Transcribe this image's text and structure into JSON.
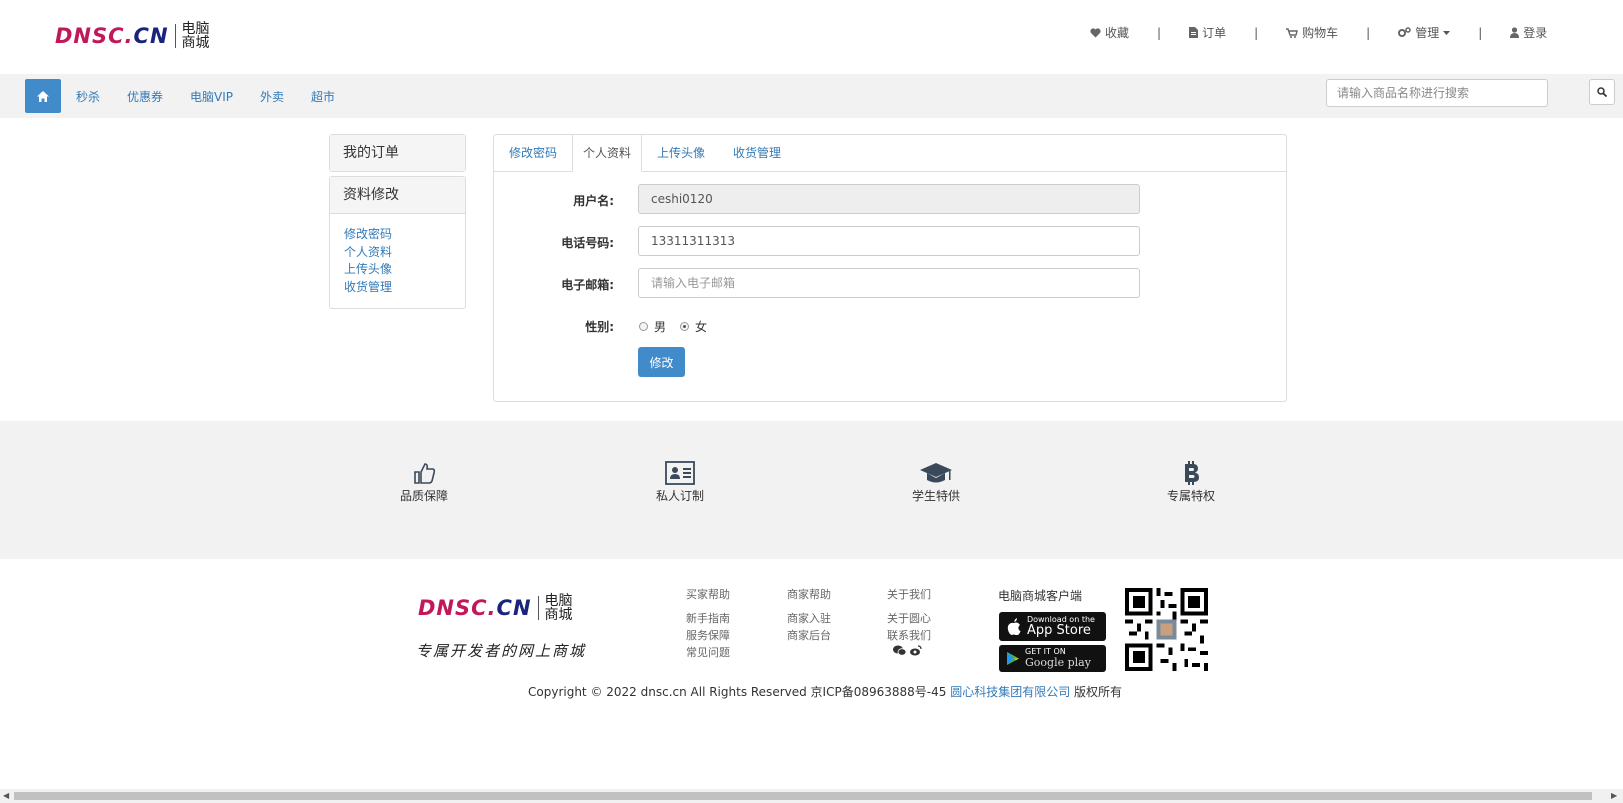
{
  "brand": {
    "logo_latin_a": "DNSC.",
    "logo_latin_b": "CN",
    "logo_cn_1": "电脑",
    "logo_cn_2": "商城",
    "colors": {
      "pink": "#c2185b",
      "navy": "#1a237e",
      "accent": "#428bca"
    }
  },
  "top_links": {
    "favorites": "收藏",
    "orders": "订单",
    "cart": "购物车",
    "manage": "管理",
    "login": "登录"
  },
  "nav": {
    "items": [
      "秒杀",
      "优惠券",
      "电脑VIP",
      "外卖",
      "超市"
    ],
    "search_placeholder": "请输入商品名称进行搜索"
  },
  "sidebar": {
    "my_orders": "我的订单",
    "profile_edit": "资料修改",
    "links": [
      "修改密码",
      "个人资料",
      "上传头像",
      "收货管理"
    ]
  },
  "tabs": [
    "修改密码",
    "个人资料",
    "上传头像",
    "收货管理"
  ],
  "active_tab": "个人资料",
  "form": {
    "username_label": "用户名:",
    "username_value": "ceshi0120",
    "phone_label": "电话号码:",
    "phone_value": "13311311313",
    "email_label": "电子邮箱:",
    "email_placeholder": "请输入电子邮箱",
    "gender_label": "性别:",
    "gender_male": "男",
    "gender_female": "女",
    "gender_selected": "女",
    "submit_label": "修改"
  },
  "features": [
    "品质保障",
    "私人订制",
    "学生特供",
    "专属特权"
  ],
  "footer": {
    "slogan": "专属开发者的网上商城",
    "columns": [
      {
        "title": "买家帮助",
        "items": [
          "新手指南",
          "服务保障",
          "常见问题"
        ]
      },
      {
        "title": "商家帮助",
        "items": [
          "商家入驻",
          "商家后台"
        ]
      },
      {
        "title": "关于我们",
        "items": [
          "关于圆心",
          "联系我们"
        ]
      }
    ],
    "client_title": "电脑商城客户端",
    "appstore_line1": "Download on the",
    "appstore_line2": "App Store",
    "googleplay_line1": "GET IT ON",
    "googleplay_line2": "Google play",
    "copyright_prefix": "Copyright © 2022 dnsc.cn All Rights Reserved 京ICP备08963888号-45 ",
    "company": "圆心科技集团有限公司",
    "copyright_suffix": " 版权所有"
  }
}
